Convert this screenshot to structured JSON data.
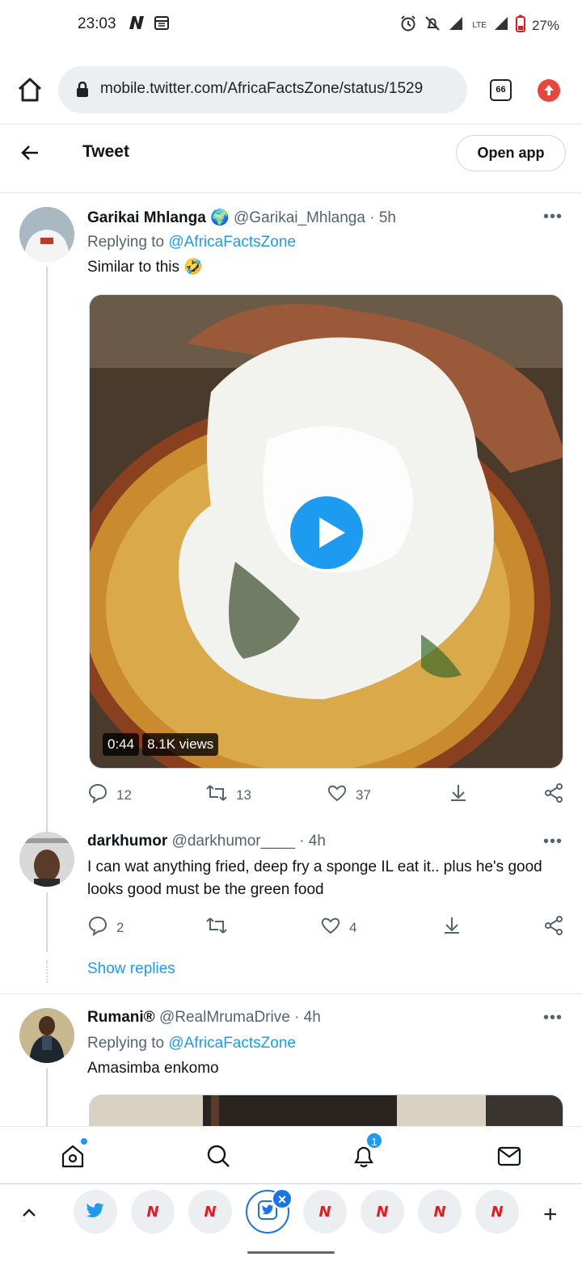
{
  "status_bar": {
    "time": "23:03",
    "network": "LTE",
    "battery": "27%"
  },
  "browser": {
    "url": "mobile.twitter.com/AfricaFactsZone/status/1529",
    "tab_count": "66"
  },
  "header": {
    "title": "Tweet",
    "open_app_label": "Open app"
  },
  "tweets": [
    {
      "name": "Garikai Mhlanga",
      "verified_emoji": "🌍",
      "handle": "@Garikai_Mhlanga",
      "time": "· 5h",
      "replying_prefix": "Replying to",
      "replying_to": "@AfricaFactsZone",
      "text": "Similar to this 🤣",
      "video": {
        "duration": "0:44",
        "views": "8.1K views"
      },
      "stats": {
        "replies": "12",
        "retweets": "13",
        "likes": "37"
      }
    },
    {
      "name": "darkhumor",
      "handle": "@darkhumor____",
      "time": "· 4h",
      "text": "I can wat anything fried, deep fry a sponge IL eat it.. plus he's good looks good must be the green food",
      "stats": {
        "replies": "2",
        "retweets": "",
        "likes": "4"
      },
      "show_replies_label": "Show replies"
    },
    {
      "name": "Rumani®",
      "handle": "@RealMrumaDrive",
      "time": "· 4h",
      "replying_prefix": "Replying to",
      "replying_to": "@AfricaFactsZone",
      "text": "Amasimba enkomo"
    }
  ],
  "bottom_nav": {
    "notification_count": "1"
  },
  "colors": {
    "accent": "#1d9bf0",
    "text_primary": "#0f1419",
    "text_secondary": "#536471",
    "border": "#cfd9de"
  }
}
